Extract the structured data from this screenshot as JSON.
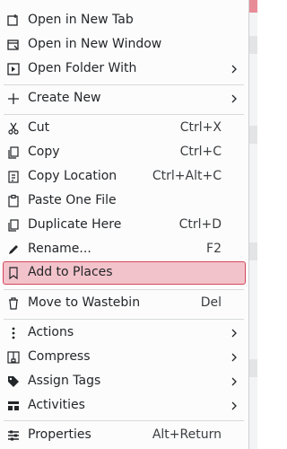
{
  "menu": {
    "items": [
      {
        "label": "Open in New Tab",
        "icon": "new-tab-icon"
      },
      {
        "label": "Open in New Window",
        "icon": "new-window-icon"
      },
      {
        "label": "Open Folder With",
        "icon": "open-folder-with-icon",
        "submenu": true
      },
      {
        "label": "Create New",
        "icon": "plus-icon",
        "submenu": true
      },
      {
        "label": "Cut",
        "icon": "scissors-icon",
        "shortcut": "Ctrl+X"
      },
      {
        "label": "Copy",
        "icon": "copy-icon",
        "shortcut": "Ctrl+C"
      },
      {
        "label": "Copy Location",
        "icon": "copy-location-icon",
        "shortcut": "Ctrl+Alt+C"
      },
      {
        "label": "Paste One File",
        "icon": "paste-icon"
      },
      {
        "label": "Duplicate Here",
        "icon": "duplicate-icon",
        "shortcut": "Ctrl+D"
      },
      {
        "label": "Rename...",
        "icon": "pencil-icon",
        "shortcut": "F2"
      },
      {
        "label": "Add to Places",
        "icon": "bookmark-icon",
        "highlighted": true
      },
      {
        "label": "Move to Wastebin",
        "icon": "trash-icon",
        "shortcut": "Del"
      },
      {
        "label": "Actions",
        "icon": "more-vertical-icon",
        "submenu": true
      },
      {
        "label": "Compress",
        "icon": "compress-icon",
        "submenu": true
      },
      {
        "label": "Assign Tags",
        "icon": "tag-icon",
        "submenu": true
      },
      {
        "label": "Activities",
        "icon": "activities-icon",
        "submenu": true
      },
      {
        "label": "Properties",
        "icon": "properties-icon",
        "shortcut": "Alt+Return"
      }
    ]
  },
  "colors": {
    "highlight_fill": "#f3c3cb",
    "highlight_border": "#d3485c",
    "text": "#232629",
    "accent_top": "#e88c98"
  }
}
